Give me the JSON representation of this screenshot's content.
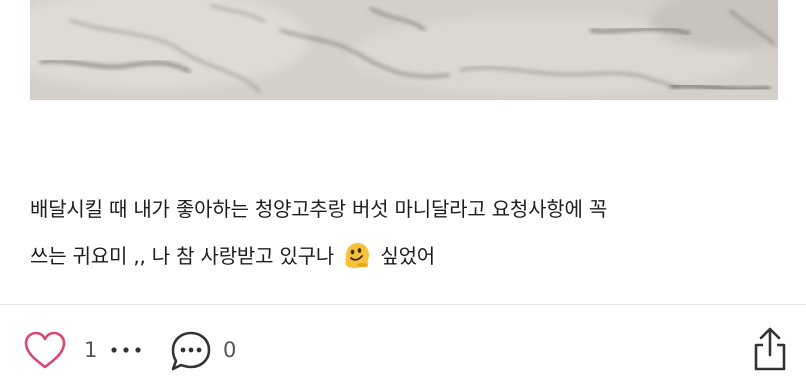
{
  "post": {
    "text_line1": "배달시킬 때 내가 좋아하는 청양고추랑 버섯 마니달라고 요청사항에 꼭",
    "text_line2_before_emoji": "쓰는 귀요미 ,, 나 참 사랑받고 있구나",
    "text_line2_after_emoji": "싶었어",
    "emoji": "melting-face-emoji"
  },
  "actions": {
    "like_count": "1",
    "comment_count": "0",
    "like_icon": "heart-icon",
    "more_icon": "ellipsis-icon",
    "comment_icon": "speech-bubble-icon",
    "share_icon": "share-icon"
  },
  "colors": {
    "text": "#1e1e1e",
    "like_heart": "#d94b6e",
    "icon_dark": "#333333",
    "count_gray": "#555555",
    "divider": "#e6e6e6"
  }
}
